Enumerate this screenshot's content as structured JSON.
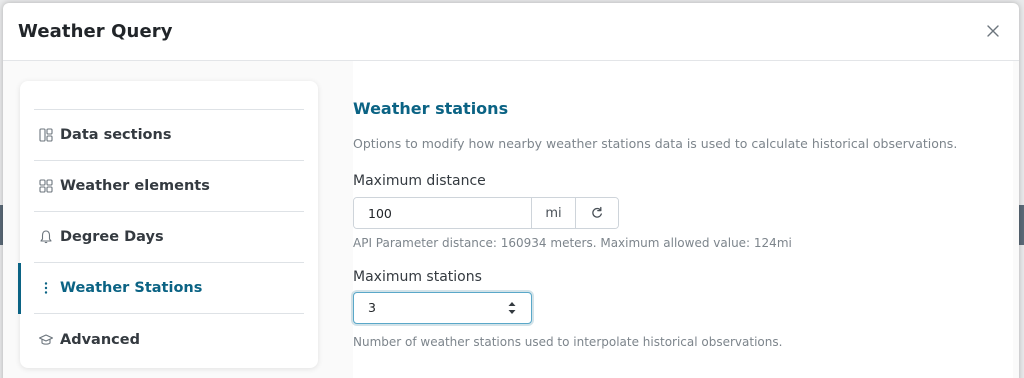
{
  "modal": {
    "title": "Weather Query"
  },
  "sidenav": {
    "items": [
      {
        "label": "Data sections",
        "icon": "columns-icon"
      },
      {
        "label": "Weather elements",
        "icon": "grid-icon"
      },
      {
        "label": "Degree Days",
        "icon": "bell-icon"
      },
      {
        "label": "Weather Stations",
        "icon": "dots-vertical-icon",
        "active": true
      },
      {
        "label": "Advanced",
        "icon": "mortarboard-icon"
      }
    ]
  },
  "section": {
    "title": "Weather stations",
    "description": "Options to modify how nearby weather stations data is used to calculate historical observations."
  },
  "max_distance": {
    "label": "Maximum distance",
    "value": "100",
    "unit": "mi",
    "help": "API Parameter distance: 160934 meters. Maximum allowed value: 124mi"
  },
  "max_stations": {
    "label": "Maximum stations",
    "value": "3",
    "help": "Number of weather stations used to interpolate historical observations."
  },
  "colors": {
    "accent": "#0b6384",
    "focus_border": "#5aa8c9"
  }
}
